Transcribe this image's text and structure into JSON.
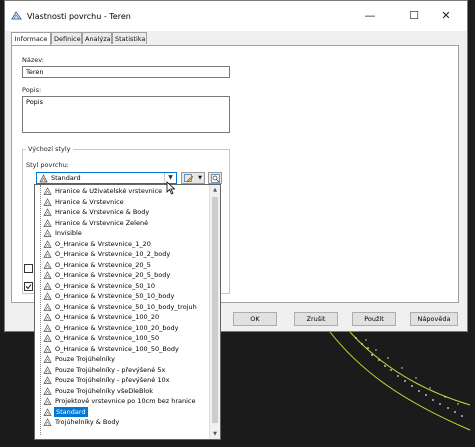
{
  "window": {
    "title": "Vlastnosti povrchu - Teren",
    "minimize_glyph": "—",
    "maximize_glyph": "☐",
    "close_glyph": "✕"
  },
  "tabs": [
    {
      "label": "Informace",
      "active": true
    },
    {
      "label": "Definice",
      "active": false
    },
    {
      "label": "Analýza",
      "active": false
    },
    {
      "label": "Statistika",
      "active": false
    }
  ],
  "info": {
    "name_label": "Název:",
    "name_value": "Teren",
    "description_label": "Popis:",
    "description_value": "Popis",
    "default_styles_label": "Výchozí styly",
    "surface_style_label": "Styl povrchu:",
    "surface_style_value": "Standard"
  },
  "dropdown": {
    "items": [
      "Hranice & Uživatelské vrstevnice",
      "Hranice & Vrstevnice",
      "Hranice & Vrstevnice & Body",
      "Hranice & Vrstevnice Zelené",
      "Invisible",
      "O_Hranice & Vrstevnice_1_20",
      "O_Hranice & Vrstevnice_10_2_body",
      "O_Hranice & Vrstevnice_20_5",
      "O_Hranice & Vrstevnice_20_5_body",
      "O_Hranice & Vrstevnice_50_10",
      "O_Hranice & Vrstevnice_50_10_body",
      "O_Hranice & Vrstevnice_50_10_body_trojuh",
      "O_Hranice & Vrstevnice_100_20",
      "O_Hranice & Vrstevnice_100_20_body",
      "O_Hranice & Vrstevnice_100_50",
      "O_Hranice & Vrstevnice_100_50_Body",
      "Pouze Trojúhelníky",
      "Pouze Trojúhelníky - převýšené 5x",
      "Pouze Trojúhelníky - převýšené 10x",
      "Pouze Trojúhelníky všeDleBlok",
      "Projektové vrstevnice po 10cm bez hranice",
      "Standard",
      "Trojúhelníky & Body"
    ],
    "selected": "Standard"
  },
  "buttons": {
    "ok": "OK",
    "cancel": "Zrušit",
    "apply": "Použít",
    "help": "Nápověda"
  },
  "colors": {
    "accent": "#0078d7",
    "drawing_line": "#c8d83a"
  }
}
